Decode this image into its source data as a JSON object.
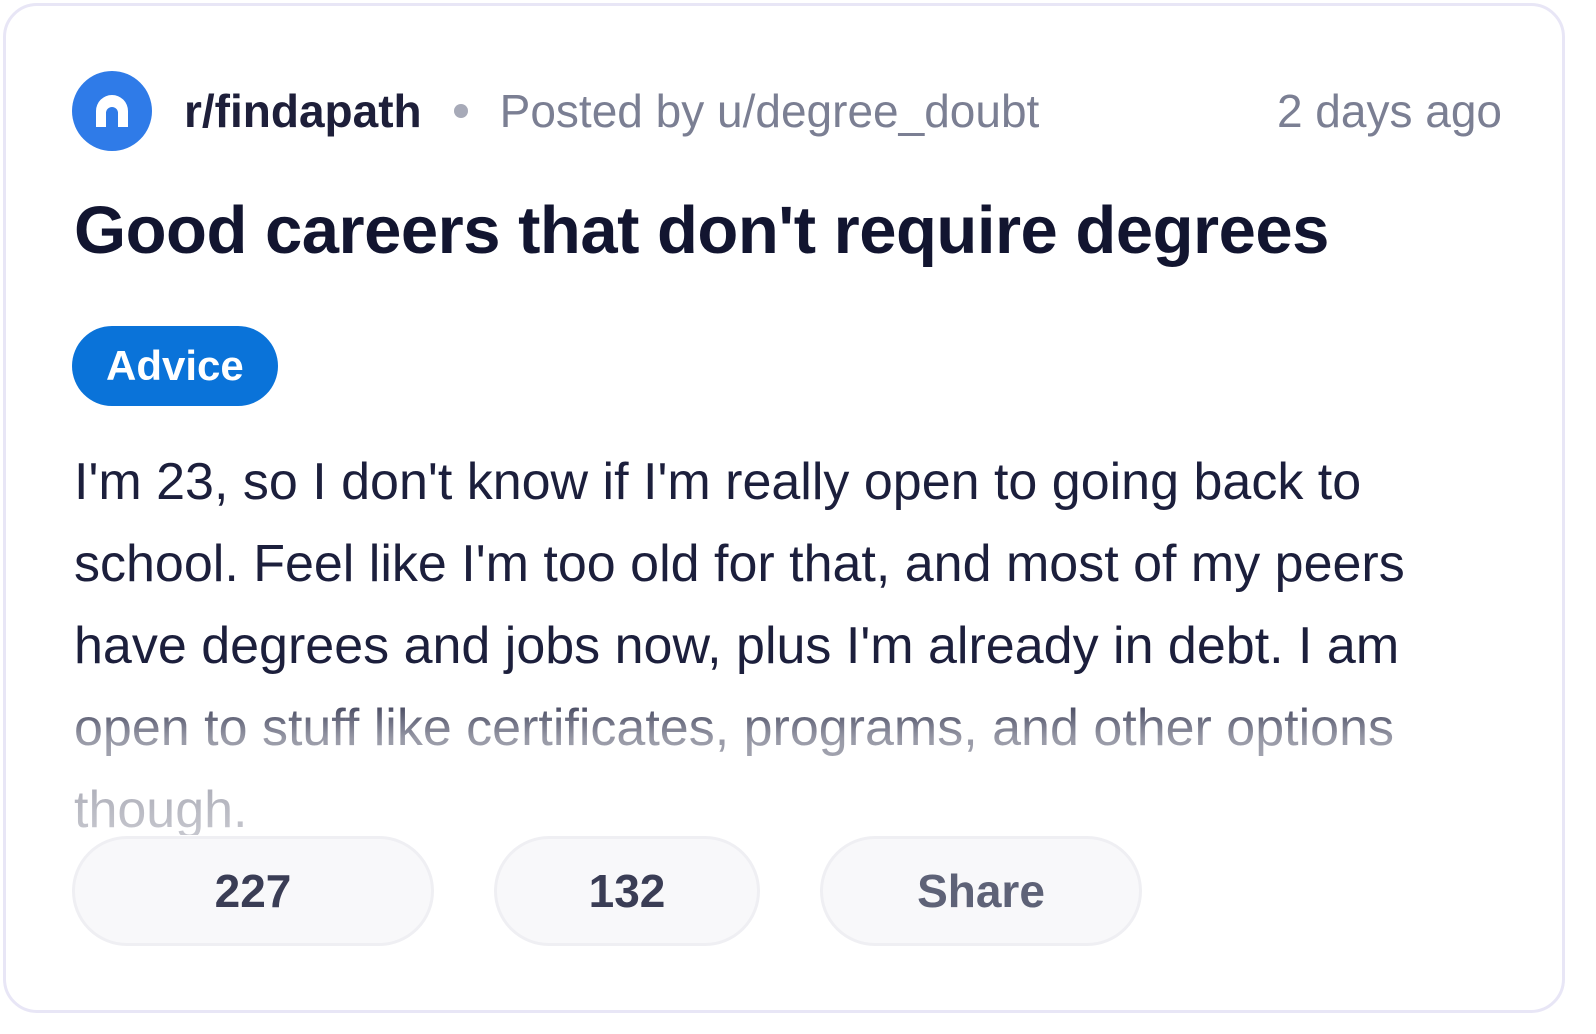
{
  "post": {
    "subreddit": "r/findapath",
    "posted_by": "Posted by u/degree_doubt",
    "time_ago": "2 days ago",
    "title": "Good careers that don't require degrees",
    "flair": "Advice",
    "body": "I'm 23, so I don't know if I'm really open to going back to school. Feel like I'm too old for that, and most of my peers have degrees and jobs now, plus I'm already in debt. I am open to stuff like certificates, programs, and other options though."
  },
  "actions": {
    "votes": "227",
    "comments": "132",
    "share_label": "Share"
  },
  "colors": {
    "avatar": "#2f7be8",
    "flair_bg": "#0a73d9",
    "title_text": "#121530",
    "muted_text": "#7b7f93",
    "card_border": "#e8e6f6"
  },
  "icons": {
    "subreddit_avatar": "subreddit-avatar-icon"
  }
}
